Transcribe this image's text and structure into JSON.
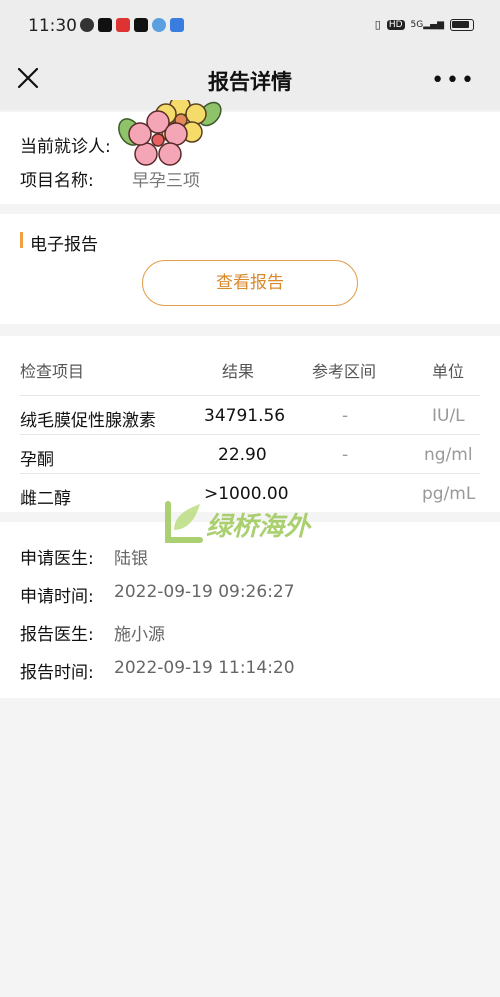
{
  "status_bar": {
    "time": "11:30",
    "hd": "HD",
    "network": "5G"
  },
  "nav": {
    "title": "报告详情",
    "more": "•••"
  },
  "patient": {
    "current_patient_label": "当前就诊人:",
    "project_name_label": "项目名称:",
    "project_name_value": "早孕三项"
  },
  "report": {
    "section_title": "电子报告",
    "view_button": "查看报告"
  },
  "results_table": {
    "headers": [
      "检查项目",
      "结果",
      "参考区间",
      "单位"
    ],
    "rows": [
      {
        "item": "绒毛膜促性腺激素",
        "result": "34791.56",
        "range": "-",
        "unit": "IU/L"
      },
      {
        "item": "孕酮",
        "result": "22.90",
        "range": "-",
        "unit": "ng/ml"
      },
      {
        "item": "雌二醇",
        "result": ">1000.00",
        "range": "",
        "unit": "pg/mL"
      }
    ]
  },
  "doctor_info": {
    "items": [
      {
        "label": "申请医生:",
        "value": "陆银"
      },
      {
        "label": "申请时间:",
        "value": "2022-09-19 09:26:27"
      },
      {
        "label": "报告医生:",
        "value": "施小源"
      },
      {
        "label": "报告时间:",
        "value": "2022-09-19 11:14:20"
      }
    ]
  },
  "watermark": {
    "text": "绿桥海外"
  },
  "colors": {
    "accent": "#e3a050",
    "accent_text": "#d88a2c",
    "page_bg": "#f4f4f4",
    "nav_bg": "#ededed",
    "watermark_green": "#9cc858"
  }
}
